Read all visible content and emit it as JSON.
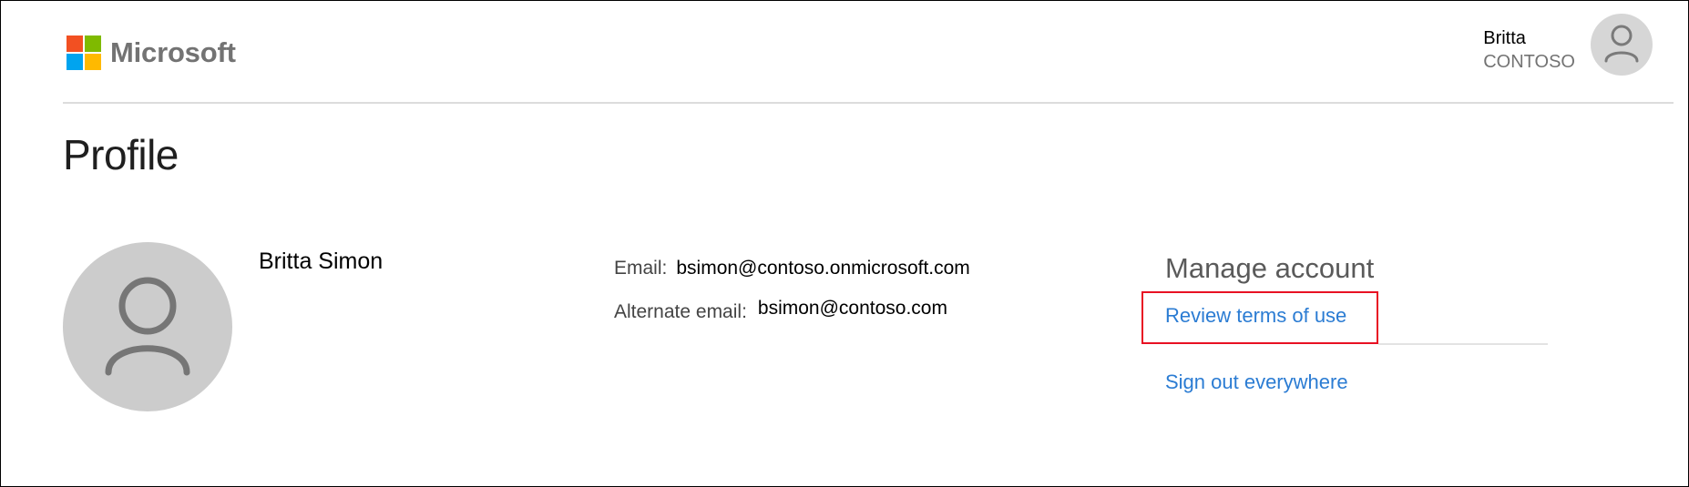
{
  "header": {
    "brand": "Microsoft",
    "logo_colors": [
      "#f25022",
      "#7fba00",
      "#00a4ef",
      "#ffb900"
    ],
    "user": {
      "name": "Britta",
      "org": "CONTOSO",
      "avatar_icon": "person-icon"
    }
  },
  "page": {
    "title": "Profile"
  },
  "profile": {
    "display_name": "Britta Simon",
    "avatar_icon": "person-icon",
    "email_label": "Email:",
    "email_value": "bsimon@contoso.onmicrosoft.com",
    "alt_email_label": "Alternate email:",
    "alt_email_value": "bsimon@contoso.com"
  },
  "manage": {
    "title": "Manage account",
    "links": [
      "Review terms of use",
      "Sign out everywhere"
    ],
    "link_color": "#2b7cd3",
    "highlight_color": "#e81123"
  }
}
